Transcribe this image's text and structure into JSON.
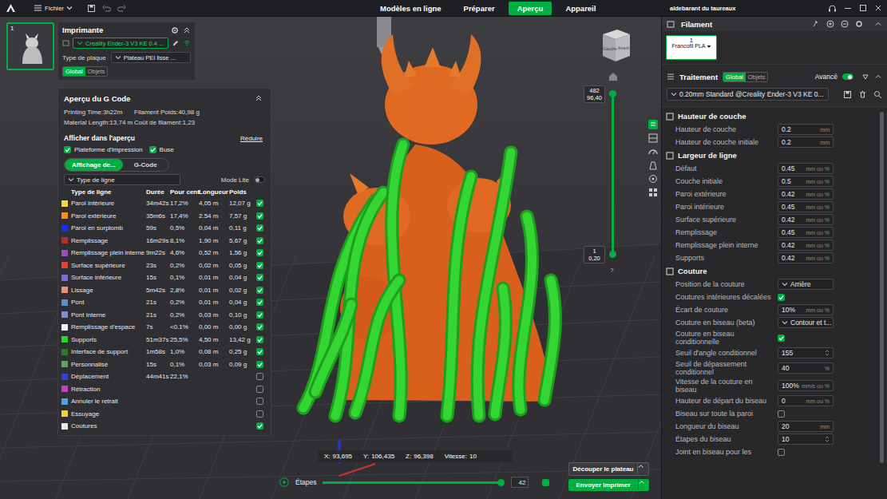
{
  "topbar": {
    "menu": "Fichier",
    "tabs": [
      {
        "label": "Modèles en ligne",
        "selected": false
      },
      {
        "label": "Préparer",
        "selected": false
      },
      {
        "label": "Aperçu",
        "selected": true
      },
      {
        "label": "Appareil",
        "selected": false
      }
    ],
    "user": "aldebarant du taureaux"
  },
  "plates": [
    {
      "number": "1",
      "selected": true
    }
  ],
  "printer": {
    "title": "Imprimante",
    "name": "Creality Ender-3 V3 KE 0.4 ...",
    "plate_label": "Type de plaque",
    "plate_value": "Plateau PEI lisse ...",
    "tabs": [
      {
        "label": "Global",
        "selected": true
      },
      {
        "label": "Objets",
        "selected": false
      }
    ]
  },
  "gcode": {
    "title": "Aperçu du G Code",
    "stats": [
      "Printing Time:3h22m",
      "Filament Poids:40,98 g",
      "Material Length:13,74 m",
      "Coût de filament:1,23"
    ],
    "show_title": "Afficher dans l'aperçu",
    "reduce": "Réduire",
    "show_options": [
      {
        "label": "Plateforme d'impression",
        "checked": true
      },
      {
        "label": "Buse",
        "checked": true
      }
    ],
    "view_tabs": [
      {
        "label": "Affichage de...",
        "selected": true
      },
      {
        "label": "G-Code",
        "selected": false
      }
    ],
    "line_type": "Type de ligne",
    "mode_lite": {
      "label": "Mode Lite",
      "on": false
    },
    "columns": [
      "Type de ligne",
      "Durée",
      "Pour cent",
      "Longueur",
      "Poids"
    ],
    "rows": [
      {
        "label": "Paroi intérieure",
        "color": "#f5d63d",
        "duration": "34m42s",
        "percent": "17,2%",
        "length": "4,05 m",
        "weight": "12,07 g",
        "checked": true
      },
      {
        "label": "Paroi extérieure",
        "color": "#ff8a1c",
        "duration": "35m6s",
        "percent": "17,4%",
        "length": "2.54 m",
        "weight": "7,57 g",
        "checked": true
      },
      {
        "label": "Paroi en surplomb",
        "color": "#1a2cff",
        "duration": "59s",
        "percent": "0,5%",
        "length": "0,04 m",
        "weight": "0,11 g",
        "checked": true
      },
      {
        "label": "Remplissage",
        "color": "#b2302c",
        "duration": "16m29s",
        "percent": "8,1%",
        "length": "1,90 m",
        "weight": "5,67 g",
        "checked": true
      },
      {
        "label": "Remplissage plein interne",
        "color": "#9a4fbf",
        "duration": "9m22s",
        "percent": "4,6%",
        "length": "0,52 m",
        "weight": "1,56 g",
        "checked": true
      },
      {
        "label": "Surface supérieure",
        "color": "#e8403a",
        "duration": "23s",
        "percent": "0,2%",
        "length": "0,02 m",
        "weight": "0,05 g",
        "checked": true
      },
      {
        "label": "Surface inférieure",
        "color": "#7a6bd6",
        "duration": "15s",
        "percent": "0,1%",
        "length": "0,01 m",
        "weight": "0,04 g",
        "checked": true
      },
      {
        "label": "Lissage",
        "color": "#e89478",
        "duration": "5m42s",
        "percent": "2,8%",
        "length": "0,01 m",
        "weight": "0,02 g",
        "checked": true
      },
      {
        "label": "Pont",
        "color": "#5b8fc7",
        "duration": "21s",
        "percent": "0,2%",
        "length": "0,01 m",
        "weight": "0,04 g",
        "checked": true
      },
      {
        "label": "Pont interne",
        "color": "#7f8fd0",
        "duration": "21s",
        "percent": "0,2%",
        "length": "0,03 m",
        "weight": "0,10 g",
        "checked": true
      },
      {
        "label": "Remplissage d'espace",
        "color": "#f2f2f2",
        "duration": "7s",
        "percent": "<0.1%",
        "length": "0,00 m",
        "weight": "0,00 g",
        "checked": true
      },
      {
        "label": "Supports",
        "color": "#2bd42b",
        "duration": "51m37s",
        "percent": "25,5%",
        "length": "4,50 m",
        "weight": "13,42 g",
        "checked": true
      },
      {
        "label": "Interface de support",
        "color": "#2a7a2a",
        "duration": "1m58s",
        "percent": "1,0%",
        "length": "0,08 m",
        "weight": "0,25 g",
        "checked": true
      },
      {
        "label": "Personnalisé",
        "color": "#5ea35e",
        "duration": "15s",
        "percent": "0,1%",
        "length": "0,03 m",
        "weight": "0,09 g",
        "checked": true
      },
      {
        "label": "Déplacement",
        "color": "#3344cc",
        "duration": "44m41s",
        "percent": "22,1%",
        "checked": false
      },
      {
        "label": "Rétraction",
        "color": "#c53fc5",
        "checked": false
      },
      {
        "label": "Annuler le retrait",
        "color": "#4fa0e0",
        "checked": false
      },
      {
        "label": "Essuyage",
        "color": "#f0d040",
        "checked": false
      },
      {
        "label": "Coutures",
        "color": "#e8e8e8",
        "checked": true
      }
    ]
  },
  "viewport": {
    "cube": {
      "left": "Gauche",
      "front": "Avant"
    },
    "layer_slider": {
      "top_layer": "482",
      "top_height": "96,40",
      "bottom_layer": "1",
      "bottom_height": "0,20",
      "help": "?",
      "level_top": 1,
      "level_bottom": 0
    },
    "coords": [
      {
        "label": "X:",
        "value": "93,695"
      },
      {
        "label": "Y:",
        "value": "106,435"
      },
      {
        "label": "Z:",
        "value": "96,398"
      },
      {
        "label": "Vitesse:",
        "value": "10"
      }
    ],
    "steps": {
      "label": "Étapes",
      "value": "42",
      "level": 1
    },
    "buttons": [
      {
        "label": "Découper le plateau",
        "primary": false
      },
      {
        "label": "Envoyer imprimer",
        "primary": true
      }
    ]
  },
  "filament": {
    "title": "Filament",
    "slots": [
      {
        "number": "1",
        "name": "Francofil PLA",
        "selected": true
      }
    ]
  },
  "process": {
    "title": "Traitement",
    "tabs": [
      {
        "label": "Global",
        "selected": true
      },
      {
        "label": "Objets",
        "selected": false
      }
    ],
    "advanced": {
      "label": "Avancé",
      "on": true
    },
    "profile": "0.20mm Standard @Creality Ender-3 V3 KE 0...",
    "sections": [
      {
        "title": "Hauteur de couche",
        "rows": [
          {
            "kind": "input",
            "label": "Hauteur de couche",
            "value": "0.2",
            "unit": "mm"
          },
          {
            "kind": "input",
            "label": "Hauteur de couche initiale",
            "value": "0.2",
            "unit": "mm"
          }
        ]
      },
      {
        "title": "Largeur de ligne",
        "rows": [
          {
            "kind": "input",
            "label": "Défaut",
            "value": "0.45",
            "unit": "mm ou %"
          },
          {
            "kind": "input",
            "label": "Couche initiale",
            "value": "0.5",
            "unit": "mm ou %"
          },
          {
            "kind": "input",
            "label": "Paroi extérieure",
            "value": "0.42",
            "unit": "mm ou %"
          },
          {
            "kind": "input",
            "label": "Paroi intérieure",
            "value": "0.45",
            "unit": "mm ou %"
          },
          {
            "kind": "input",
            "label": "Surface supérieure",
            "value": "0.42",
            "unit": "mm ou %"
          },
          {
            "kind": "input",
            "label": "Remplissage",
            "value": "0.45",
            "unit": "mm ou %"
          },
          {
            "kind": "input",
            "label": "Remplissage plein interne",
            "value": "0.42",
            "unit": "mm ou %"
          },
          {
            "kind": "input",
            "label": "Supports",
            "value": "0.42",
            "unit": "mm ou %"
          }
        ]
      },
      {
        "title": "Couture",
        "rows": [
          {
            "kind": "select",
            "label": "Position de la couture",
            "value": "Arrière"
          },
          {
            "kind": "checkbox",
            "label": "Coutures intérieures décalées",
            "checked": true
          },
          {
            "kind": "input",
            "label": "Écart de couture",
            "value": "10%",
            "unit": "mm ou %"
          },
          {
            "kind": "select",
            "label": "Couture en biseau (beta)",
            "value": "Contour et t..."
          },
          {
            "kind": "checkbox",
            "label": "Couture en biseau conditionnelle",
            "checked": true
          },
          {
            "kind": "spin",
            "label": "Seuil d'angle conditionnel",
            "value": "155"
          },
          {
            "kind": "input",
            "label": "Seuil de dépassement conditionnel",
            "value": "40",
            "unit": "%"
          },
          {
            "kind": "input",
            "label": "Vitesse de la couture en biseau",
            "value": "100%",
            "unit": "mm/s ou %"
          },
          {
            "kind": "input",
            "label": "Hauteur de départ du biseau",
            "value": "0",
            "unit": "mm ou %"
          },
          {
            "kind": "checkbox",
            "label": "Biseau sur toute la paroi",
            "checked": false
          },
          {
            "kind": "input",
            "label": "Longueur du biseau",
            "value": "20",
            "unit": "mm"
          },
          {
            "kind": "spin",
            "label": "Étapes du biseau",
            "value": "10"
          },
          {
            "kind": "checkbox",
            "label": "Joint en biseau pour les",
            "checked": false
          }
        ]
      }
    ]
  }
}
